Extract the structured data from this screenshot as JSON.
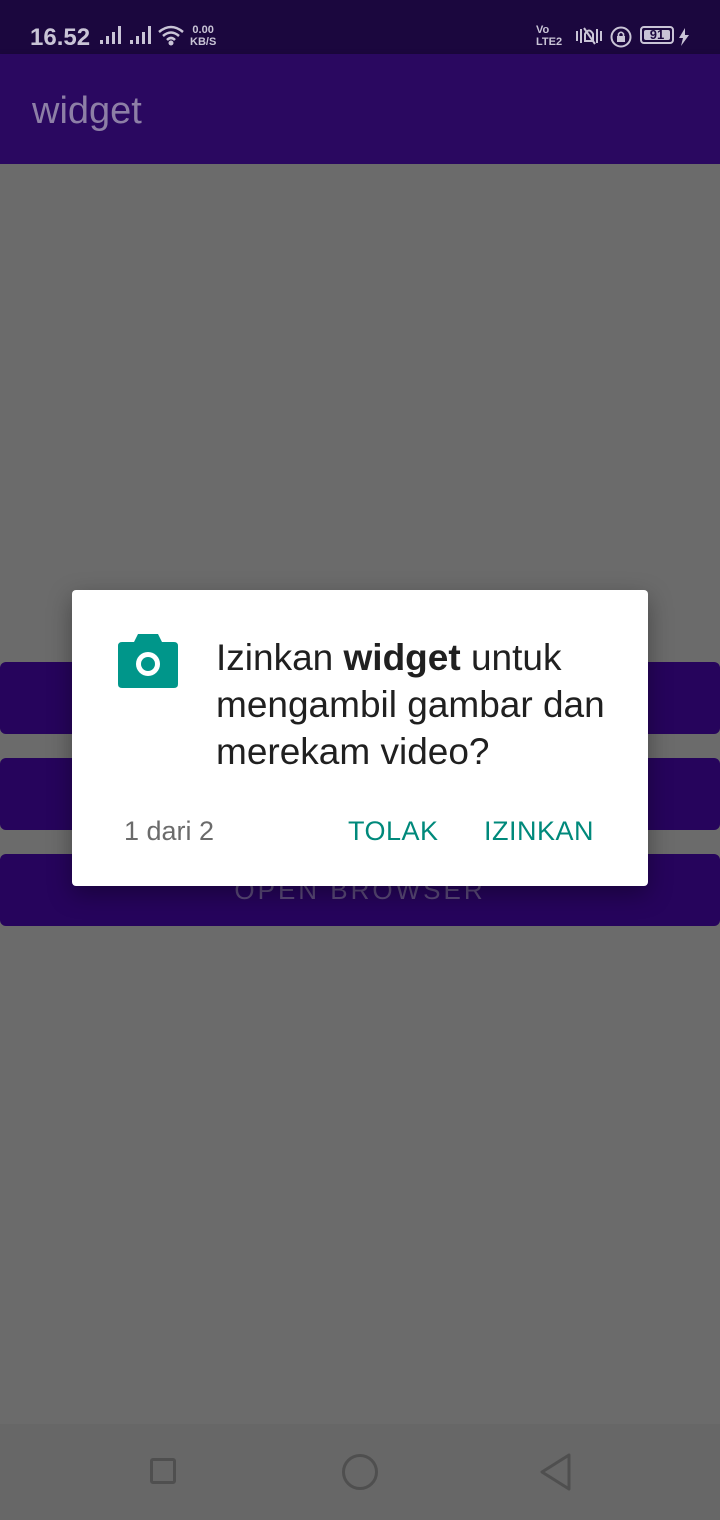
{
  "status_bar": {
    "time": "16.52",
    "net_speed_value": "0.00",
    "net_speed_unit": "KB/S",
    "volte_top": "Vo",
    "volte_bottom": "LTE2",
    "battery": "91"
  },
  "app_bar": {
    "title": "widget"
  },
  "content": {
    "buttons": [
      "",
      "",
      "OPEN BROWSER"
    ]
  },
  "dialog": {
    "message_prefix": "Izinkan ",
    "message_app": "widget",
    "message_suffix": " untuk mengambil gambar dan merekam video?",
    "counter": "1 dari 2",
    "deny_label": "TOLAK",
    "allow_label": "IZINKAN",
    "icon": "camera-icon",
    "accent_color": "#00897b"
  },
  "navigation_bar": {
    "recents_icon": "square-icon",
    "home_icon": "circle-icon",
    "back_icon": "triangle-back-icon"
  }
}
